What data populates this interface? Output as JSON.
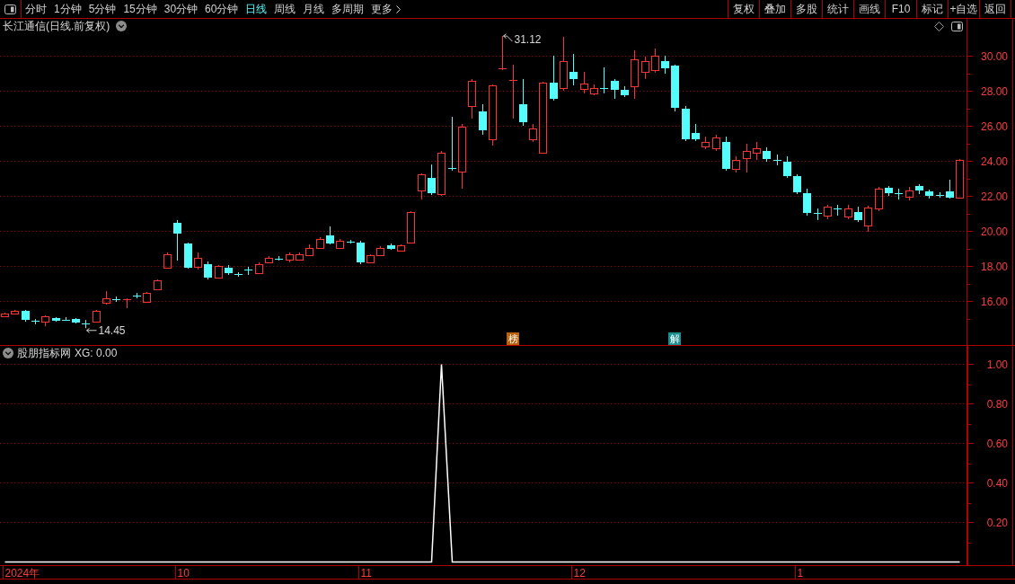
{
  "toolbar": {
    "tabs": [
      {
        "label": "分时",
        "kind": "period",
        "selected": false
      },
      {
        "label": "1分钟",
        "kind": "period",
        "selected": false
      },
      {
        "label": "5分钟",
        "kind": "period",
        "selected": false
      },
      {
        "label": "15分钟",
        "kind": "period",
        "selected": false
      },
      {
        "label": "30分钟",
        "kind": "period",
        "selected": false
      },
      {
        "label": "60分钟",
        "kind": "period",
        "selected": false
      },
      {
        "label": "日线",
        "kind": "period",
        "selected": true
      },
      {
        "label": "周线",
        "kind": "period",
        "selected": false
      },
      {
        "label": "月线",
        "kind": "period",
        "selected": false
      },
      {
        "label": "多周期",
        "kind": "period",
        "selected": false
      },
      {
        "label": "更多",
        "kind": "menu",
        "selected": false
      }
    ],
    "buttons": [
      "复权",
      "叠加",
      "多股",
      "统计",
      "画线",
      "F10",
      "标记",
      "+自选",
      "返回"
    ]
  },
  "price_chart": {
    "title": "长江通信(日线.前复权)",
    "markers": [
      {
        "text": "榜",
        "color": "#b8620f"
      },
      {
        "text": "解",
        "color": "#1b8f8f"
      }
    ],
    "chart_data": {
      "type": "candlestick",
      "ohlc": [
        [
          15.13,
          15.33,
          15.08,
          15.28
        ],
        [
          15.28,
          15.49,
          15.23,
          15.44
        ],
        [
          15.44,
          15.49,
          14.82,
          14.92
        ],
        [
          14.87,
          14.97,
          14.67,
          14.86
        ],
        [
          14.82,
          15.18,
          14.56,
          15.13
        ],
        [
          15.03,
          15.08,
          14.82,
          14.87
        ],
        [
          14.92,
          15.08,
          14.87,
          14.91
        ],
        [
          14.97,
          15.03,
          14.72,
          14.77
        ],
        [
          14.72,
          14.92,
          14.45,
          14.71
        ],
        [
          14.82,
          15.49,
          14.77,
          15.44
        ],
        [
          15.9,
          16.56,
          15.79,
          16.15
        ],
        [
          16.1,
          16.26,
          15.95,
          16.09
        ],
        [
          16.1,
          16.15,
          15.59,
          16.11
        ],
        [
          16.31,
          16.46,
          16.15,
          16.3
        ],
        [
          15.95,
          16.51,
          15.9,
          16.46
        ],
        [
          16.67,
          17.23,
          16.62,
          17.18
        ],
        [
          17.9,
          18.77,
          17.85,
          18.67
        ],
        [
          20.46,
          20.62,
          18.31,
          19.85
        ],
        [
          19.28,
          19.33,
          17.85,
          17.9
        ],
        [
          17.95,
          18.77,
          17.8,
          18.46
        ],
        [
          18.1,
          18.26,
          17.23,
          17.33
        ],
        [
          17.33,
          18.05,
          17.28,
          18.0
        ],
        [
          17.9,
          18.05,
          17.49,
          17.59
        ],
        [
          17.54,
          17.64,
          17.38,
          17.53
        ],
        [
          17.79,
          17.95,
          17.49,
          17.78
        ],
        [
          17.59,
          18.21,
          17.54,
          18.1
        ],
        [
          18.21,
          18.56,
          18.15,
          18.46
        ],
        [
          18.41,
          18.56,
          18.31,
          18.4
        ],
        [
          18.36,
          18.77,
          18.21,
          18.67
        ],
        [
          18.36,
          18.77,
          18.31,
          18.67
        ],
        [
          18.62,
          19.23,
          18.56,
          19.03
        ],
        [
          19.03,
          19.64,
          18.97,
          19.54
        ],
        [
          19.74,
          20.26,
          19.23,
          19.28
        ],
        [
          19.03,
          19.54,
          18.97,
          19.44
        ],
        [
          19.38,
          19.49,
          19.28,
          19.37
        ],
        [
          19.33,
          19.44,
          18.1,
          18.21
        ],
        [
          18.21,
          18.67,
          18.15,
          18.62
        ],
        [
          18.62,
          19.13,
          18.56,
          19.03
        ],
        [
          19.18,
          19.28,
          18.92,
          18.97
        ],
        [
          18.87,
          19.23,
          18.82,
          19.18
        ],
        [
          19.33,
          21.13,
          19.28,
          21.08
        ],
        [
          22.31,
          23.28,
          21.79,
          23.23
        ],
        [
          23.03,
          23.79,
          22.05,
          22.15
        ],
        [
          22.1,
          24.56,
          22.0,
          24.46
        ],
        [
          23.59,
          26.51,
          23.44,
          23.58
        ],
        [
          23.38,
          26.1,
          22.41,
          25.95
        ],
        [
          27.13,
          28.67,
          26.41,
          28.56
        ],
        [
          26.82,
          27.23,
          25.49,
          25.74
        ],
        [
          25.23,
          28.36,
          24.87,
          28.31
        ],
        [
          29.28,
          31.12,
          29.18,
          29.29
        ],
        [
          28.62,
          29.49,
          26.41,
          28.63
        ],
        [
          27.23,
          28.67,
          26.0,
          26.21
        ],
        [
          25.23,
          26.1,
          25.08,
          25.85
        ],
        [
          24.46,
          28.51,
          24.41,
          28.46
        ],
        [
          28.46,
          30.0,
          27.44,
          27.54
        ],
        [
          28.15,
          31.08,
          28.0,
          29.69
        ],
        [
          29.08,
          30.1,
          28.31,
          28.67
        ],
        [
          28.1,
          29.08,
          27.85,
          28.41
        ],
        [
          27.85,
          28.36,
          27.74,
          28.15
        ],
        [
          28.15,
          29.33,
          27.85,
          28.14
        ],
        [
          28.56,
          28.67,
          27.54,
          28.05
        ],
        [
          28.05,
          28.26,
          27.64,
          27.74
        ],
        [
          28.26,
          30.31,
          27.54,
          29.79
        ],
        [
          29.08,
          29.95,
          28.67,
          29.69
        ],
        [
          29.18,
          30.41,
          29.03,
          30.0
        ],
        [
          29.69,
          30.0,
          28.97,
          29.28
        ],
        [
          29.44,
          29.49,
          26.82,
          27.03
        ],
        [
          26.97,
          27.13,
          25.13,
          25.23
        ],
        [
          25.59,
          26.1,
          25.13,
          25.23
        ],
        [
          24.82,
          25.38,
          24.67,
          25.08
        ],
        [
          24.72,
          25.49,
          24.56,
          25.33
        ],
        [
          25.08,
          25.38,
          23.44,
          23.54
        ],
        [
          23.54,
          24.26,
          23.33,
          24.05
        ],
        [
          24.15,
          24.97,
          23.33,
          24.56
        ],
        [
          24.46,
          25.08,
          24.05,
          24.72
        ],
        [
          24.56,
          24.77,
          23.95,
          24.1
        ],
        [
          24.05,
          24.36,
          23.74,
          24.04
        ],
        [
          23.95,
          24.26,
          23.03,
          23.13
        ],
        [
          23.13,
          23.23,
          22.1,
          22.21
        ],
        [
          22.15,
          22.41,
          20.87,
          21.03
        ],
        [
          21.03,
          21.28,
          20.62,
          21.02
        ],
        [
          20.87,
          21.49,
          20.67,
          21.38
        ],
        [
          21.28,
          21.49,
          20.87,
          21.27
        ],
        [
          20.82,
          21.49,
          20.67,
          21.28
        ],
        [
          21.08,
          21.38,
          20.51,
          20.62
        ],
        [
          20.31,
          21.44,
          19.95,
          21.33
        ],
        [
          21.28,
          22.51,
          21.13,
          22.41
        ],
        [
          22.46,
          22.56,
          22.0,
          22.15
        ],
        [
          22.15,
          22.41,
          21.79,
          22.14
        ],
        [
          21.95,
          22.51,
          21.74,
          22.31
        ],
        [
          22.56,
          22.67,
          22.1,
          22.31
        ],
        [
          22.26,
          22.36,
          21.85,
          22.0
        ],
        [
          22.05,
          22.21,
          21.9,
          22.04
        ],
        [
          22.26,
          22.92,
          21.85,
          21.9
        ],
        [
          21.9,
          24.1,
          21.85,
          24.05
        ]
      ],
      "ylim": [
        13.49,
        32.1
      ],
      "yticks": [
        {
          "value": 30,
          "label": "30.00"
        },
        {
          "value": 28,
          "label": "28.00"
        },
        {
          "value": 26,
          "label": "26.00"
        },
        {
          "value": 24,
          "label": "24.00"
        },
        {
          "value": 22,
          "label": "22.00"
        },
        {
          "value": 20,
          "label": "20.00"
        },
        {
          "value": 18,
          "label": "18.00"
        },
        {
          "value": 16,
          "label": "16.00"
        }
      ],
      "grid": true,
      "annotations": [
        "31.12",
        "14.45"
      ]
    }
  },
  "indicator_panel": {
    "name": "股朋指标网",
    "readout": "XG: 0.00",
    "chart_data": {
      "type": "line",
      "series": [
        {
          "color": "#ffffff",
          "values": [
            0,
            0,
            0,
            0,
            0,
            0,
            0,
            0,
            0,
            0,
            0,
            0,
            0,
            0,
            0,
            0,
            0,
            0,
            0,
            0,
            0,
            0,
            0,
            0,
            0,
            0,
            0,
            0,
            0,
            0,
            0,
            0,
            0,
            0,
            0,
            0,
            0,
            0,
            0,
            0,
            0,
            0,
            0,
            1,
            0,
            0,
            0,
            0,
            0,
            0,
            0,
            0,
            0,
            0,
            0,
            0,
            0,
            0,
            0,
            0,
            0,
            0,
            0,
            0,
            0,
            0,
            0,
            0,
            0,
            0,
            0,
            0,
            0,
            0,
            0,
            0,
            0,
            0,
            0,
            0,
            0,
            0,
            0,
            0,
            0,
            0,
            0,
            0,
            0,
            0,
            0,
            0,
            0,
            0,
            0
          ]
        }
      ],
      "ylim": [
        -0.016,
        1.093
      ],
      "yticks": [
        {
          "value": 1,
          "label": "1.00"
        },
        {
          "value": 0.8,
          "label": "0.80"
        },
        {
          "value": 0.6,
          "label": "0.60"
        },
        {
          "value": 0.4,
          "label": "0.40"
        },
        {
          "value": 0.2,
          "label": "0.20"
        }
      ],
      "grid": true
    }
  },
  "date_axis": {
    "labels": [
      "2024年",
      "10",
      "11",
      "12",
      "1"
    ]
  }
}
